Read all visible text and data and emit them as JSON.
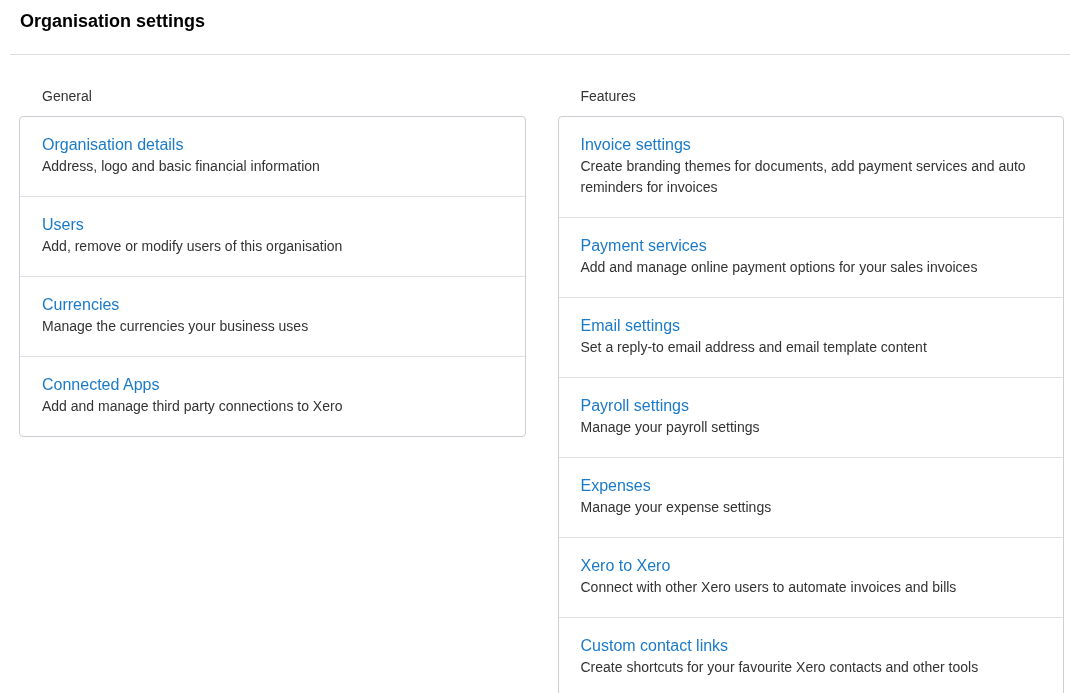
{
  "page": {
    "title": "Organisation settings"
  },
  "sections": [
    {
      "heading": "General",
      "items": [
        {
          "title": "Organisation details",
          "description": "Address, logo and basic financial information"
        },
        {
          "title": "Users",
          "description": "Add, remove or modify users of this organisation"
        },
        {
          "title": "Currencies",
          "description": "Manage the currencies your business uses"
        },
        {
          "title": "Connected Apps",
          "description": "Add and manage third party connections to Xero"
        }
      ]
    },
    {
      "heading": "Features",
      "items": [
        {
          "title": "Invoice settings",
          "description": "Create branding themes for documents, add payment services and auto reminders for invoices"
        },
        {
          "title": "Payment services",
          "description": "Add and manage online payment options for your sales invoices"
        },
        {
          "title": "Email settings",
          "description": "Set a reply-to email address and email template content"
        },
        {
          "title": "Payroll settings",
          "description": "Manage your payroll settings"
        },
        {
          "title": "Expenses",
          "description": "Manage your expense settings"
        },
        {
          "title": "Xero to Xero",
          "description": "Connect with other Xero users to automate invoices and bills"
        },
        {
          "title": "Custom contact links",
          "description": "Create shortcuts for your favourite Xero contacts and other tools"
        }
      ]
    }
  ]
}
